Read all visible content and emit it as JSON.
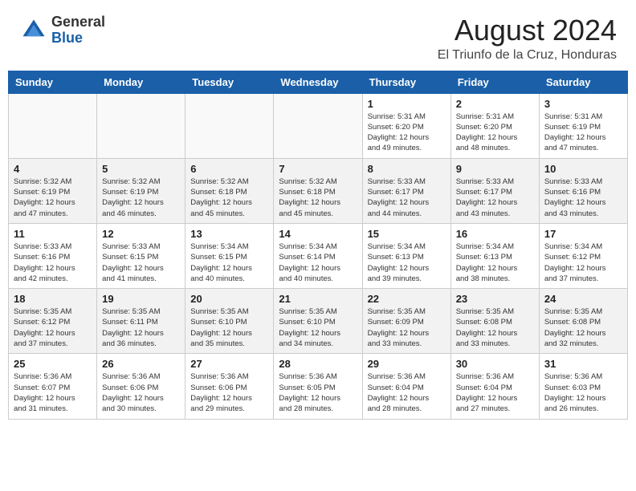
{
  "header": {
    "logo_general": "General",
    "logo_blue": "Blue",
    "month_year": "August 2024",
    "location": "El Triunfo de la Cruz, Honduras"
  },
  "days_of_week": [
    "Sunday",
    "Monday",
    "Tuesday",
    "Wednesday",
    "Thursday",
    "Friday",
    "Saturday"
  ],
  "weeks": [
    {
      "alt": false,
      "days": [
        {
          "num": "",
          "info": ""
        },
        {
          "num": "",
          "info": ""
        },
        {
          "num": "",
          "info": ""
        },
        {
          "num": "",
          "info": ""
        },
        {
          "num": "1",
          "info": "Sunrise: 5:31 AM\nSunset: 6:20 PM\nDaylight: 12 hours\nand 49 minutes."
        },
        {
          "num": "2",
          "info": "Sunrise: 5:31 AM\nSunset: 6:20 PM\nDaylight: 12 hours\nand 48 minutes."
        },
        {
          "num": "3",
          "info": "Sunrise: 5:31 AM\nSunset: 6:19 PM\nDaylight: 12 hours\nand 47 minutes."
        }
      ]
    },
    {
      "alt": true,
      "days": [
        {
          "num": "4",
          "info": "Sunrise: 5:32 AM\nSunset: 6:19 PM\nDaylight: 12 hours\nand 47 minutes."
        },
        {
          "num": "5",
          "info": "Sunrise: 5:32 AM\nSunset: 6:19 PM\nDaylight: 12 hours\nand 46 minutes."
        },
        {
          "num": "6",
          "info": "Sunrise: 5:32 AM\nSunset: 6:18 PM\nDaylight: 12 hours\nand 45 minutes."
        },
        {
          "num": "7",
          "info": "Sunrise: 5:32 AM\nSunset: 6:18 PM\nDaylight: 12 hours\nand 45 minutes."
        },
        {
          "num": "8",
          "info": "Sunrise: 5:33 AM\nSunset: 6:17 PM\nDaylight: 12 hours\nand 44 minutes."
        },
        {
          "num": "9",
          "info": "Sunrise: 5:33 AM\nSunset: 6:17 PM\nDaylight: 12 hours\nand 43 minutes."
        },
        {
          "num": "10",
          "info": "Sunrise: 5:33 AM\nSunset: 6:16 PM\nDaylight: 12 hours\nand 43 minutes."
        }
      ]
    },
    {
      "alt": false,
      "days": [
        {
          "num": "11",
          "info": "Sunrise: 5:33 AM\nSunset: 6:16 PM\nDaylight: 12 hours\nand 42 minutes."
        },
        {
          "num": "12",
          "info": "Sunrise: 5:33 AM\nSunset: 6:15 PM\nDaylight: 12 hours\nand 41 minutes."
        },
        {
          "num": "13",
          "info": "Sunrise: 5:34 AM\nSunset: 6:15 PM\nDaylight: 12 hours\nand 40 minutes."
        },
        {
          "num": "14",
          "info": "Sunrise: 5:34 AM\nSunset: 6:14 PM\nDaylight: 12 hours\nand 40 minutes."
        },
        {
          "num": "15",
          "info": "Sunrise: 5:34 AM\nSunset: 6:13 PM\nDaylight: 12 hours\nand 39 minutes."
        },
        {
          "num": "16",
          "info": "Sunrise: 5:34 AM\nSunset: 6:13 PM\nDaylight: 12 hours\nand 38 minutes."
        },
        {
          "num": "17",
          "info": "Sunrise: 5:34 AM\nSunset: 6:12 PM\nDaylight: 12 hours\nand 37 minutes."
        }
      ]
    },
    {
      "alt": true,
      "days": [
        {
          "num": "18",
          "info": "Sunrise: 5:35 AM\nSunset: 6:12 PM\nDaylight: 12 hours\nand 37 minutes."
        },
        {
          "num": "19",
          "info": "Sunrise: 5:35 AM\nSunset: 6:11 PM\nDaylight: 12 hours\nand 36 minutes."
        },
        {
          "num": "20",
          "info": "Sunrise: 5:35 AM\nSunset: 6:10 PM\nDaylight: 12 hours\nand 35 minutes."
        },
        {
          "num": "21",
          "info": "Sunrise: 5:35 AM\nSunset: 6:10 PM\nDaylight: 12 hours\nand 34 minutes."
        },
        {
          "num": "22",
          "info": "Sunrise: 5:35 AM\nSunset: 6:09 PM\nDaylight: 12 hours\nand 33 minutes."
        },
        {
          "num": "23",
          "info": "Sunrise: 5:35 AM\nSunset: 6:08 PM\nDaylight: 12 hours\nand 33 minutes."
        },
        {
          "num": "24",
          "info": "Sunrise: 5:35 AM\nSunset: 6:08 PM\nDaylight: 12 hours\nand 32 minutes."
        }
      ]
    },
    {
      "alt": false,
      "days": [
        {
          "num": "25",
          "info": "Sunrise: 5:36 AM\nSunset: 6:07 PM\nDaylight: 12 hours\nand 31 minutes."
        },
        {
          "num": "26",
          "info": "Sunrise: 5:36 AM\nSunset: 6:06 PM\nDaylight: 12 hours\nand 30 minutes."
        },
        {
          "num": "27",
          "info": "Sunrise: 5:36 AM\nSunset: 6:06 PM\nDaylight: 12 hours\nand 29 minutes."
        },
        {
          "num": "28",
          "info": "Sunrise: 5:36 AM\nSunset: 6:05 PM\nDaylight: 12 hours\nand 28 minutes."
        },
        {
          "num": "29",
          "info": "Sunrise: 5:36 AM\nSunset: 6:04 PM\nDaylight: 12 hours\nand 28 minutes."
        },
        {
          "num": "30",
          "info": "Sunrise: 5:36 AM\nSunset: 6:04 PM\nDaylight: 12 hours\nand 27 minutes."
        },
        {
          "num": "31",
          "info": "Sunrise: 5:36 AM\nSunset: 6:03 PM\nDaylight: 12 hours\nand 26 minutes."
        }
      ]
    }
  ]
}
